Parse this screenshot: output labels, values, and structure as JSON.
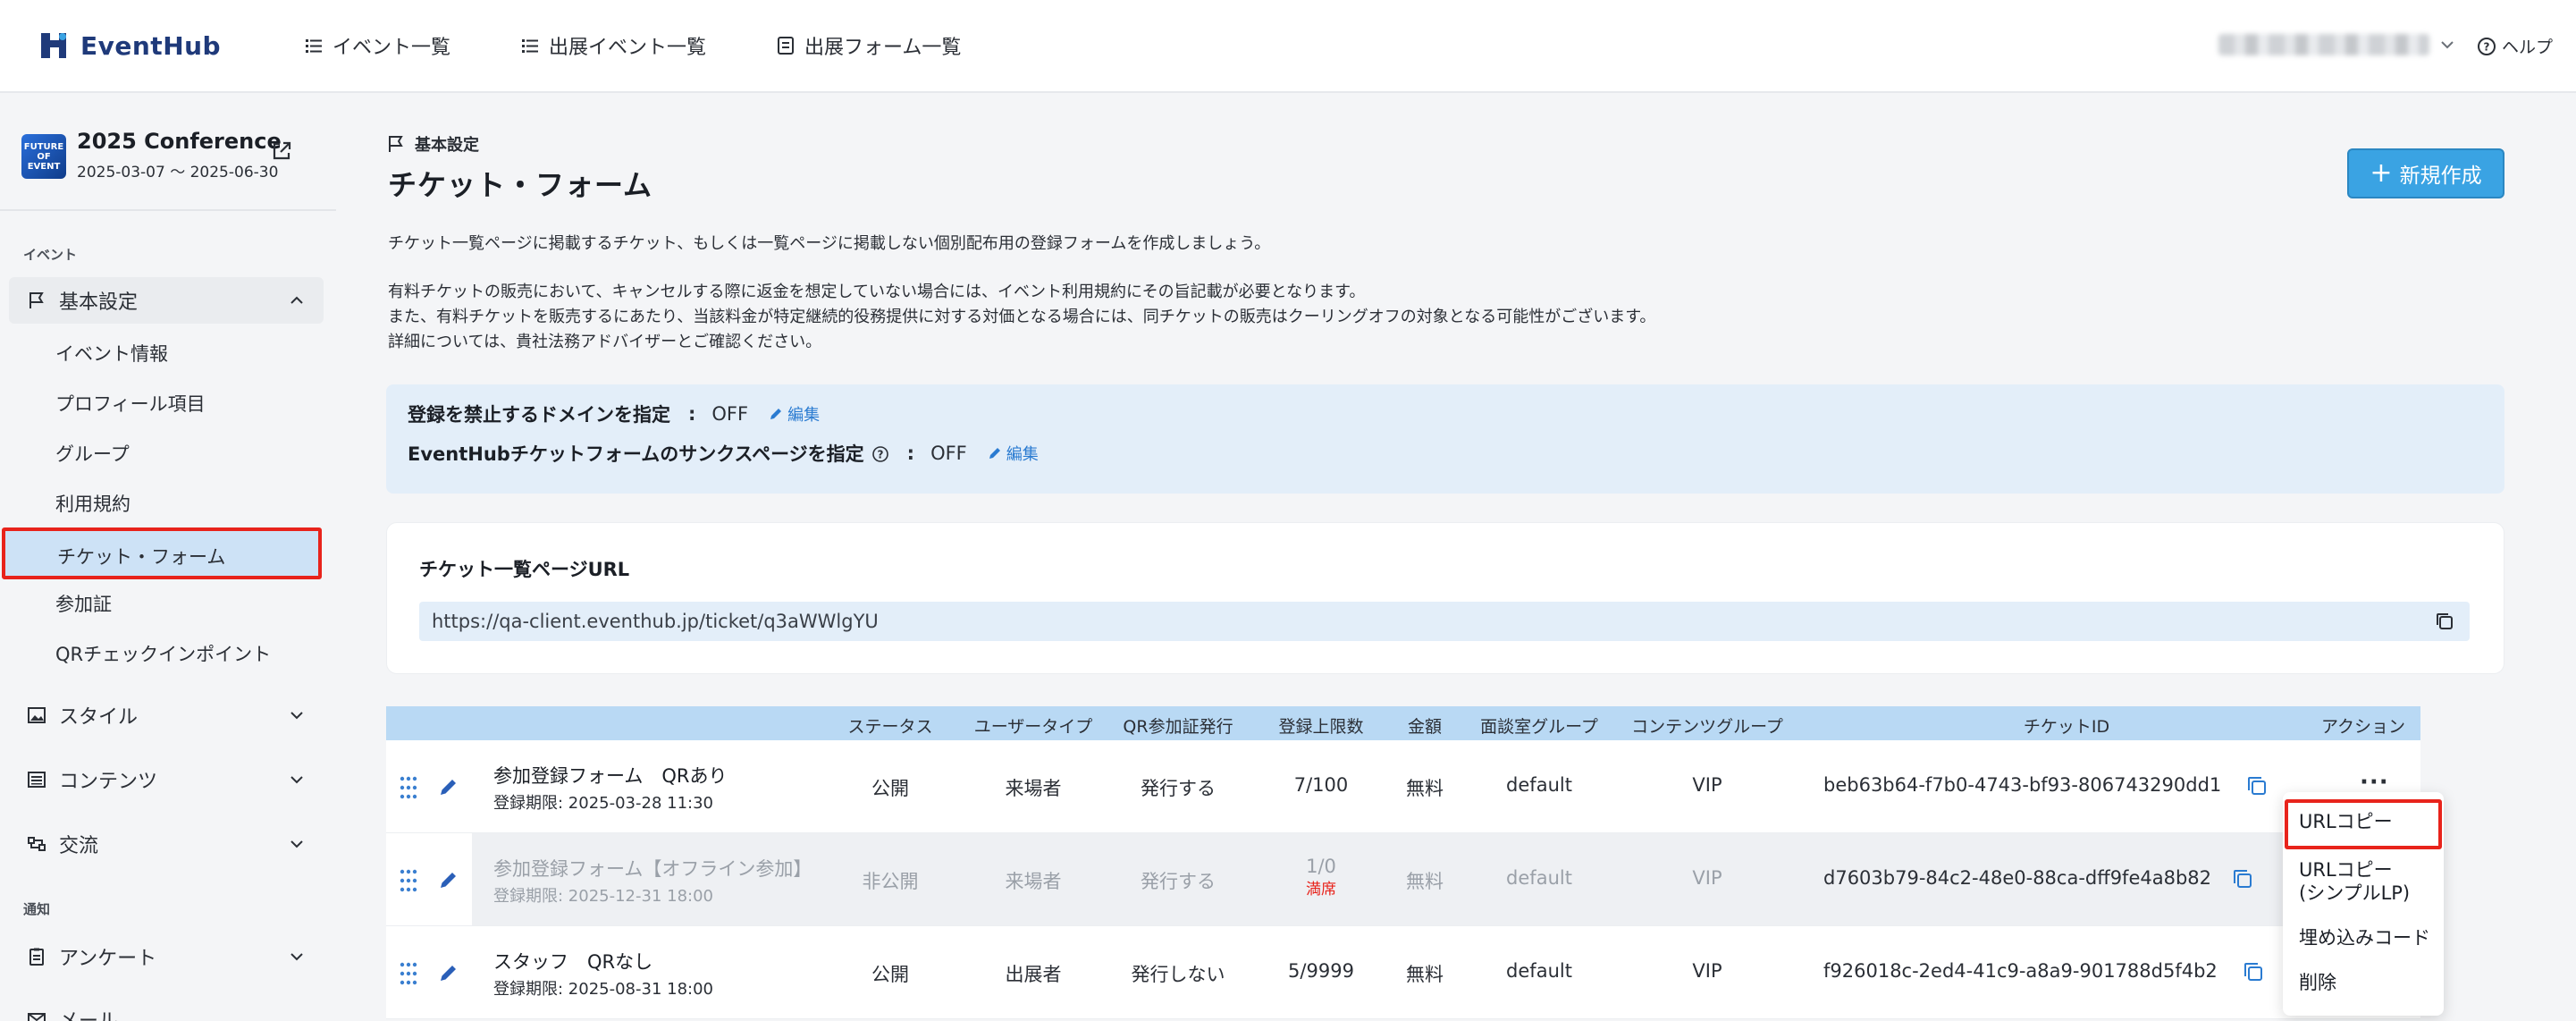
{
  "brand": {
    "name": "EventHub"
  },
  "topnav": {
    "items": [
      {
        "label": "イベント一覧",
        "icon": "list-icon"
      },
      {
        "label": "出展イベント一覧",
        "icon": "list-icon"
      },
      {
        "label": "出展フォーム一覧",
        "icon": "form-icon"
      }
    ],
    "help": "ヘルプ"
  },
  "event": {
    "thumb_text": "FUTURE OF EVENT",
    "title": "2025 Conference",
    "dates": "2025-03-07 〜 2025-06-30"
  },
  "sidebar": {
    "section_event": "イベント",
    "basic_settings": "基本設定",
    "sub_items": [
      "イベント情報",
      "プロフィール項目",
      "グループ",
      "利用規約",
      "チケット・フォーム",
      "参加証",
      "QRチェックインポイント"
    ],
    "style": "スタイル",
    "contents": "コンテンツ",
    "exchange": "交流",
    "section_notify": "通知",
    "survey": "アンケート",
    "mail": "メール"
  },
  "main": {
    "breadcrumb": "基本設定",
    "title": "チケット・フォーム",
    "new_button": "新規作成",
    "desc1": "チケット一覧ページに掲載するチケット、もしくは一覧ページに掲載しない個別配布用の登録フォームを作成しましょう。",
    "desc2": "有料チケットの販売において、キャンセルする際に返金を想定していない場合には、イベント利用規約にその旨記載が必要となります。",
    "desc3": "また、有料チケットを販売するにあたり、当該料金が特定継続的役務提供に対する対価となる場合には、同チケットの販売はクーリングオフの対象となる可能性がございます。",
    "desc4": "詳細については、貴社法務アドバイザーとご確認ください。"
  },
  "settings": {
    "domain_label": "登録を禁止するドメインを指定",
    "domain_value": "OFF",
    "thanks_label": "EventHubチケットフォームのサンクスページを指定",
    "thanks_value": "OFF",
    "colon": ":",
    "edit": "編集"
  },
  "url_card": {
    "label": "チケット一覧ページURL",
    "url": "https://qa-client.eventhub.jp/ticket/q3aWWlgYU"
  },
  "table": {
    "headers": {
      "status": "ステータス",
      "user_type": "ユーザータイプ",
      "qr": "QR参加証発行",
      "limit": "登録上限数",
      "price": "金額",
      "meeting": "面談室グループ",
      "content": "コンテンツグループ",
      "ticket_id": "チケットID",
      "action": "アクション"
    },
    "rows": [
      {
        "name": "参加登録フォーム　QRあり",
        "deadline": "登録期限: 2025-03-28 11:30",
        "status": "公開",
        "user_type": "来場者",
        "qr": "発行する",
        "limit": "7/100",
        "full": "",
        "price": "無料",
        "meeting": "default",
        "content": "VIP",
        "ticket_id": "beb63b64-f7b0-4743-bf93-806743290dd1"
      },
      {
        "name": "参加登録フォーム【オフライン参加】",
        "deadline": "登録期限: 2025-12-31 18:00",
        "status": "非公開",
        "user_type": "来場者",
        "qr": "発行する",
        "limit": "1/0",
        "full": "満席",
        "price": "無料",
        "meeting": "default",
        "content": "VIP",
        "ticket_id": "d7603b79-84c2-48e0-88ca-dff9fe4a8b82"
      },
      {
        "name": "スタッフ　QRなし",
        "deadline": "登録期限: 2025-08-31 18:00",
        "status": "公開",
        "user_type": "出展者",
        "qr": "発行しない",
        "limit": "5/9999",
        "full": "",
        "price": "無料",
        "meeting": "default",
        "content": "VIP",
        "ticket_id": "f926018c-2ed4-41c9-a8a9-901788d5f4b2"
      }
    ],
    "action_dots": "···"
  },
  "menu": {
    "items": [
      "URLコピー",
      "URLコピー\n(シンプルLP)",
      "埋め込みコード",
      "削除"
    ]
  },
  "colors": {
    "accent": "#3aa3e3",
    "highlight": "#e8231b",
    "brand": "#1f3a7a"
  }
}
